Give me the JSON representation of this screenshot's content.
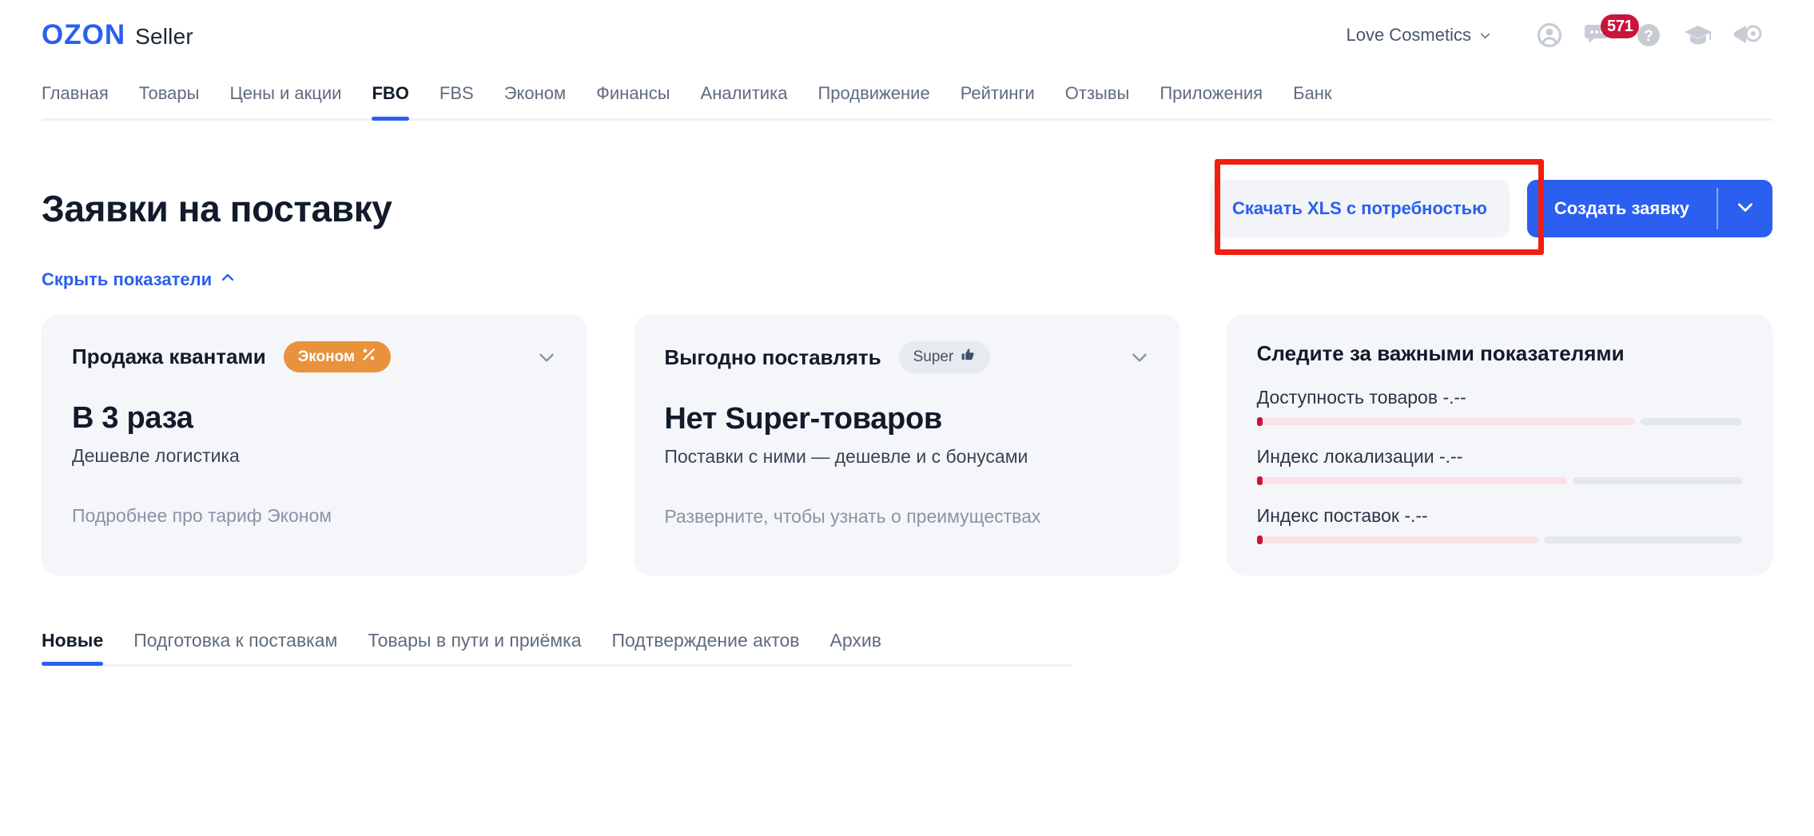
{
  "header": {
    "brand_primary": "OZON",
    "brand_secondary": "Seller",
    "brand_color": "#2a5fef",
    "account_name": "Love Cosmetics",
    "icons": [
      {
        "name": "account-icon",
        "label": "Профиль"
      },
      {
        "name": "chat-icon",
        "label": "Чаты",
        "badge": "571",
        "badge_color": "#c9153b"
      },
      {
        "name": "help-icon",
        "label": "Помощь"
      },
      {
        "name": "learning-icon",
        "label": "Обучение"
      },
      {
        "name": "announcements-icon",
        "label": "Новости"
      }
    ]
  },
  "nav": {
    "items": [
      {
        "label": "Главная",
        "active": false
      },
      {
        "label": "Товары",
        "active": false
      },
      {
        "label": "Цены и акции",
        "active": false
      },
      {
        "label": "FBO",
        "active": true
      },
      {
        "label": "FBS",
        "active": false
      },
      {
        "label": "Эконом",
        "active": false
      },
      {
        "label": "Финансы",
        "active": false
      },
      {
        "label": "Аналитика",
        "active": false
      },
      {
        "label": "Продвижение",
        "active": false
      },
      {
        "label": "Рейтинги",
        "active": false
      },
      {
        "label": "Отзывы",
        "active": false
      },
      {
        "label": "Приложения",
        "active": false
      },
      {
        "label": "Банк",
        "active": false
      }
    ]
  },
  "main": {
    "title": "Заявки на поставку",
    "download_xls_label": "Скачать XLS с потребностью",
    "create_request_label": "Создать заявку",
    "toggle_metrics_label": "Скрыть показатели",
    "highlight_color": "#f21d0e",
    "cards": [
      {
        "title": "Продажа квантами",
        "pill": "Эконом",
        "pill_icon": "percent-icon",
        "pill_color": "#e8923c",
        "headline": "В 3 раза",
        "subtitle": "Дешевле логистика",
        "footer": "Подробнее про тариф Эконом"
      },
      {
        "title": "Выгодно поставлять",
        "pill": "Super",
        "pill_icon": "thumbs-up-icon",
        "pill_color": "#e7eaf0",
        "headline": "Нет Super-товаров",
        "subtitle": "Поставки с ними — дешевле и с бонусами",
        "footer": "Разверните, чтобы узнать о преимуществах"
      }
    ],
    "metrics_card": {
      "title": "Следите за важными показателями",
      "metrics": [
        {
          "label": "Доступность товаров -.--",
          "pink_pct": 78,
          "marker_color": "#c9153b"
        },
        {
          "label": "Индекс локализации -.--",
          "pink_pct": 64,
          "marker_color": "#c9153b"
        },
        {
          "label": "Индекс поставок -.--",
          "pink_pct": 58,
          "marker_color": "#c9153b"
        }
      ]
    },
    "subtabs": [
      {
        "label": "Новые",
        "active": true
      },
      {
        "label": "Подготовка к поставкам",
        "active": false
      },
      {
        "label": "Товары в пути и приёмка",
        "active": false
      },
      {
        "label": "Подтверждение актов",
        "active": false
      },
      {
        "label": "Архив",
        "active": false
      }
    ]
  }
}
